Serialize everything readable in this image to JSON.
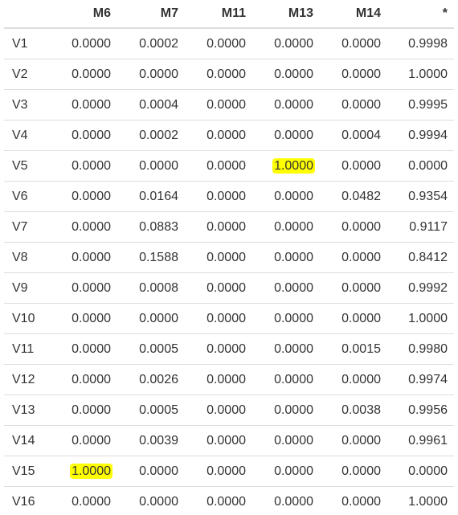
{
  "table": {
    "columns": [
      "",
      "M6",
      "M7",
      "M11",
      "M13",
      "M14",
      "*"
    ],
    "rows": [
      {
        "label": "V1",
        "values": [
          "0.0000",
          "0.0002",
          "0.0000",
          "0.0000",
          "0.0000",
          "0.9998"
        ]
      },
      {
        "label": "V2",
        "values": [
          "0.0000",
          "0.0000",
          "0.0000",
          "0.0000",
          "0.0000",
          "1.0000"
        ]
      },
      {
        "label": "V3",
        "values": [
          "0.0000",
          "0.0004",
          "0.0000",
          "0.0000",
          "0.0000",
          "0.9995"
        ]
      },
      {
        "label": "V4",
        "values": [
          "0.0000",
          "0.0002",
          "0.0000",
          "0.0000",
          "0.0004",
          "0.9994"
        ]
      },
      {
        "label": "V5",
        "values": [
          "0.0000",
          "0.0000",
          "0.0000",
          "1.0000",
          "0.0000",
          "0.0000"
        ]
      },
      {
        "label": "V6",
        "values": [
          "0.0000",
          "0.0164",
          "0.0000",
          "0.0000",
          "0.0482",
          "0.9354"
        ]
      },
      {
        "label": "V7",
        "values": [
          "0.0000",
          "0.0883",
          "0.0000",
          "0.0000",
          "0.0000",
          "0.9117"
        ]
      },
      {
        "label": "V8",
        "values": [
          "0.0000",
          "0.1588",
          "0.0000",
          "0.0000",
          "0.0000",
          "0.8412"
        ]
      },
      {
        "label": "V9",
        "values": [
          "0.0000",
          "0.0008",
          "0.0000",
          "0.0000",
          "0.0000",
          "0.9992"
        ]
      },
      {
        "label": "V10",
        "values": [
          "0.0000",
          "0.0000",
          "0.0000",
          "0.0000",
          "0.0000",
          "1.0000"
        ]
      },
      {
        "label": "V11",
        "values": [
          "0.0000",
          "0.0005",
          "0.0000",
          "0.0000",
          "0.0015",
          "0.9980"
        ]
      },
      {
        "label": "V12",
        "values": [
          "0.0000",
          "0.0026",
          "0.0000",
          "0.0000",
          "0.0000",
          "0.9974"
        ]
      },
      {
        "label": "V13",
        "values": [
          "0.0000",
          "0.0005",
          "0.0000",
          "0.0000",
          "0.0038",
          "0.9956"
        ]
      },
      {
        "label": "V14",
        "values": [
          "0.0000",
          "0.0039",
          "0.0000",
          "0.0000",
          "0.0000",
          "0.9961"
        ]
      },
      {
        "label": "V15",
        "values": [
          "1.0000",
          "0.0000",
          "0.0000",
          "0.0000",
          "0.0000",
          "0.0000"
        ]
      },
      {
        "label": "V16",
        "values": [
          "0.0000",
          "0.0000",
          "0.0000",
          "0.0000",
          "0.0000",
          "1.0000"
        ]
      }
    ],
    "highlights": [
      {
        "row": 4,
        "col": 3
      },
      {
        "row": 14,
        "col": 0
      }
    ]
  },
  "colors": {
    "highlight": "#ffff00",
    "text": "#333333",
    "rule": "#dddddd"
  }
}
